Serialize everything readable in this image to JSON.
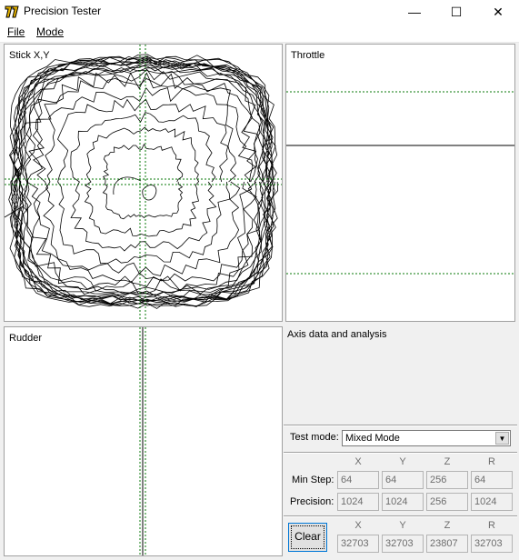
{
  "window": {
    "title": "Precision Tester",
    "minimize_glyph": "—",
    "maximize_glyph": "☐",
    "close_glyph": "✕"
  },
  "menu": {
    "file": "File",
    "mode": "Mode"
  },
  "panels": {
    "stick": "Stick X,Y",
    "throttle": "Throttle",
    "rudder": "Rudder",
    "info": "Axis data and analysis"
  },
  "test_mode": {
    "label": "Test mode:",
    "value": "Mixed Mode"
  },
  "stats": {
    "headers": [
      "X",
      "Y",
      "Z",
      "R"
    ],
    "min_step_label": "Min Step:",
    "min_step": [
      "64",
      "64",
      "256",
      "64"
    ],
    "precision_label": "Precision:",
    "precision": [
      "1024",
      "1024",
      "256",
      "1024"
    ]
  },
  "raw": {
    "headers": [
      "X",
      "Y",
      "Z",
      "R"
    ],
    "values": [
      "32703",
      "32703",
      "23807",
      "32703"
    ],
    "clear_label": "Clear"
  },
  "colors": {
    "guide": "#0a7a0a",
    "trace": "#000000",
    "border": "#a0a0a0"
  }
}
